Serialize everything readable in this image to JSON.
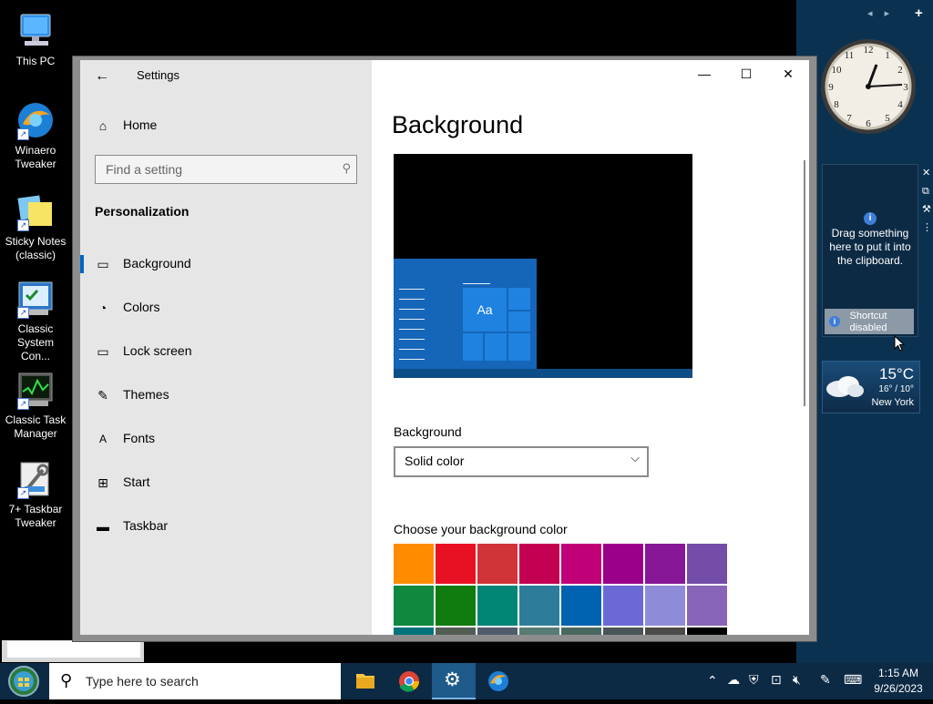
{
  "desktop": {
    "icons": [
      {
        "label": "This PC",
        "icon": "computer-icon"
      },
      {
        "label": "Winaero Tweaker",
        "icon": "winaero-icon"
      },
      {
        "label": "Sticky Notes (classic)",
        "icon": "sticky-notes-icon"
      },
      {
        "label": "Classic System Con...",
        "icon": "control-panel-icon"
      },
      {
        "label": "Classic Task Manager",
        "icon": "task-manager-icon"
      },
      {
        "label": "7+ Taskbar Tweaker",
        "icon": "taskbar-tweaker-icon"
      }
    ]
  },
  "gadgets": {
    "nav_prev": "◂",
    "nav_next": "▸",
    "add": "+",
    "clipboard_drag_text": "Drag something here to put it into the clipboard.",
    "clipboard_shortcut": "Shortcut disabled",
    "weather_temp": "15°C",
    "weather_range": "16° / 10°",
    "weather_city": "New York",
    "clock_time": "1:15"
  },
  "settings": {
    "title": "Settings",
    "home": "Home",
    "search_placeholder": "Find a setting",
    "section": "Personalization",
    "nav": [
      {
        "label": "Background",
        "icon": "picture-icon"
      },
      {
        "label": "Colors",
        "icon": "palette-icon"
      },
      {
        "label": "Lock screen",
        "icon": "lock-screen-icon"
      },
      {
        "label": "Themes",
        "icon": "brush-icon"
      },
      {
        "label": "Fonts",
        "icon": "font-icon"
      },
      {
        "label": "Start",
        "icon": "start-icon"
      },
      {
        "label": "Taskbar",
        "icon": "taskbar-icon"
      }
    ],
    "page_title": "Background",
    "preview_sample": "Aa",
    "background_label": "Background",
    "background_value": "Solid color",
    "color_label": "Choose your background color",
    "colors": [
      "#ff8c00",
      "#e81123",
      "#d13438",
      "#c30052",
      "#bf0077",
      "#9a0089",
      "#881798",
      "#744da9",
      "#10893e",
      "#107c10",
      "#018574",
      "#2d7d9a",
      "#0063b1",
      "#6b69d6",
      "#8e8cd8",
      "#8764b8",
      "#00737a",
      "#525e54",
      "#515c6b",
      "#567c73",
      "#486860",
      "#4a5459",
      "#4c4a48",
      "#000000"
    ]
  },
  "taskbar": {
    "search_placeholder": "Type here to search",
    "time": "1:15 AM",
    "date": "9/26/2023"
  },
  "colors": {
    "accent": "#0067c0",
    "taskbar_bg": "#0d2a45",
    "desktop_right": "#0b3150"
  }
}
